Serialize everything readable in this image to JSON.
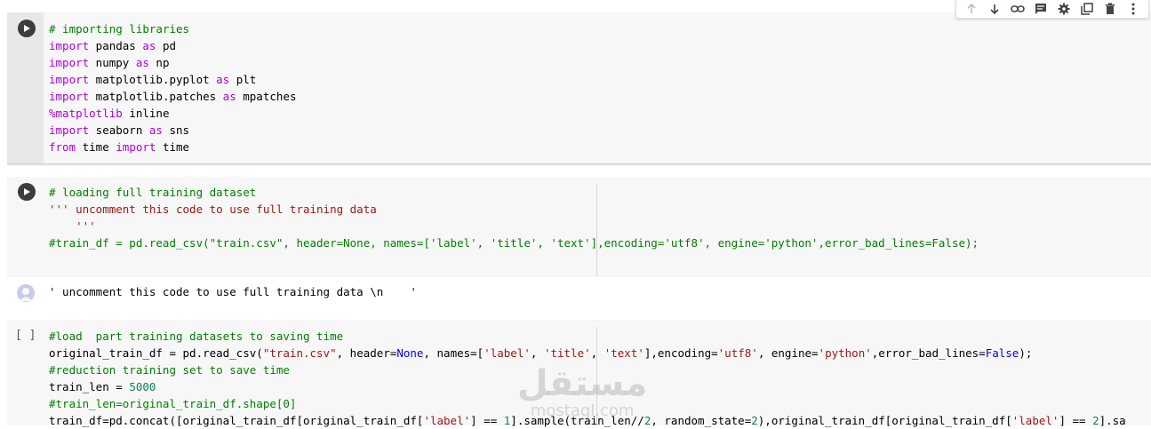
{
  "cells": [
    {
      "lines": [
        [
          {
            "t": "# importing libraries",
            "c": "cm"
          }
        ],
        [
          {
            "t": "import",
            "c": "kw"
          },
          {
            "t": " pandas "
          },
          {
            "t": "as",
            "c": "kw"
          },
          {
            "t": " pd"
          }
        ],
        [
          {
            "t": "import",
            "c": "kw"
          },
          {
            "t": " numpy "
          },
          {
            "t": "as",
            "c": "kw"
          },
          {
            "t": " np"
          }
        ],
        [
          {
            "t": "import",
            "c": "kw"
          },
          {
            "t": " matplotlib.pyplot "
          },
          {
            "t": "as",
            "c": "kw"
          },
          {
            "t": " plt"
          }
        ],
        [
          {
            "t": "import",
            "c": "kw"
          },
          {
            "t": " matplotlib.patches "
          },
          {
            "t": "as",
            "c": "kw"
          },
          {
            "t": " mpatches"
          }
        ],
        [
          {
            "t": "%matplotlib",
            "c": "kw"
          },
          {
            "t": " inline"
          }
        ],
        [
          {
            "t": "import",
            "c": "kw"
          },
          {
            "t": " seaborn "
          },
          {
            "t": "as",
            "c": "kw"
          },
          {
            "t": " sns"
          }
        ],
        [
          {
            "t": "from",
            "c": "kw"
          },
          {
            "t": " time "
          },
          {
            "t": "import",
            "c": "kw"
          },
          {
            "t": " time"
          }
        ]
      ]
    },
    {
      "lines": [
        [
          {
            "t": "# loading full training dataset",
            "c": "cm"
          }
        ],
        [
          {
            "t": "''' uncomment this code to use full training data",
            "c": "st"
          }
        ],
        [
          {
            "t": "    '''",
            "c": "st"
          }
        ],
        [
          {
            "t": "#train_df = pd.read_csv(\"train.csv\", header=None, names=['label', 'title', 'text'],encoding='utf8', engine='python',error_bad_lines=False);",
            "c": "cm"
          }
        ]
      ]
    },
    {
      "lines": [
        [
          {
            "t": "#load  part training datasets to saving time",
            "c": "cm"
          }
        ],
        [
          {
            "t": "original_train_df = pd.read_csv("
          },
          {
            "t": "\"train.csv\"",
            "c": "st"
          },
          {
            "t": ", header="
          },
          {
            "t": "None",
            "c": "bi"
          },
          {
            "t": ", names=["
          },
          {
            "t": "'label'",
            "c": "st"
          },
          {
            "t": ", "
          },
          {
            "t": "'title'",
            "c": "st"
          },
          {
            "t": ", "
          },
          {
            "t": "'text'",
            "c": "st"
          },
          {
            "t": "],encoding="
          },
          {
            "t": "'utf8'",
            "c": "st"
          },
          {
            "t": ", engine="
          },
          {
            "t": "'python'",
            "c": "st"
          },
          {
            "t": ",error_bad_lines="
          },
          {
            "t": "False",
            "c": "bi"
          },
          {
            "t": ");"
          }
        ],
        [
          {
            "t": "#reduction training set to save time",
            "c": "cm"
          }
        ],
        [
          {
            "t": "train_len = "
          },
          {
            "t": "5000",
            "c": "nm"
          }
        ],
        [
          {
            "t": "#train_len=original_train_df.shape[0]",
            "c": "cm"
          }
        ],
        [
          {
            "t": "train_df=pd.concat([original_train_df[original_train_df["
          },
          {
            "t": "'label'",
            "c": "st"
          },
          {
            "t": "] == "
          },
          {
            "t": "1",
            "c": "nm"
          },
          {
            "t": "].sample(train_len//"
          },
          {
            "t": "2",
            "c": "nm"
          },
          {
            "t": ", random_state="
          },
          {
            "t": "2",
            "c": "nm"
          },
          {
            "t": "),original_train_df[original_train_df["
          },
          {
            "t": "'label'",
            "c": "st"
          },
          {
            "t": "] == "
          },
          {
            "t": "2",
            "c": "nm"
          },
          {
            "t": "].sa"
          }
        ]
      ]
    }
  ],
  "output": {
    "text": "' uncomment this code to use full training data \\n    '"
  },
  "cell3_bracket": "[ ]",
  "watermark": {
    "arabic": "مستقل",
    "latin": "mostaql.com"
  },
  "toolbar": {
    "icons": [
      "arrow-up-icon",
      "arrow-down-icon",
      "link-icon",
      "comment-icon",
      "gear-icon",
      "mirror-cell-icon",
      "trash-icon",
      "more-vert-icon"
    ]
  },
  "colors": {
    "keyword": "#af00db",
    "comment": "#008000",
    "string": "#a31515",
    "number": "#098658",
    "builtin": "#0000ff"
  }
}
